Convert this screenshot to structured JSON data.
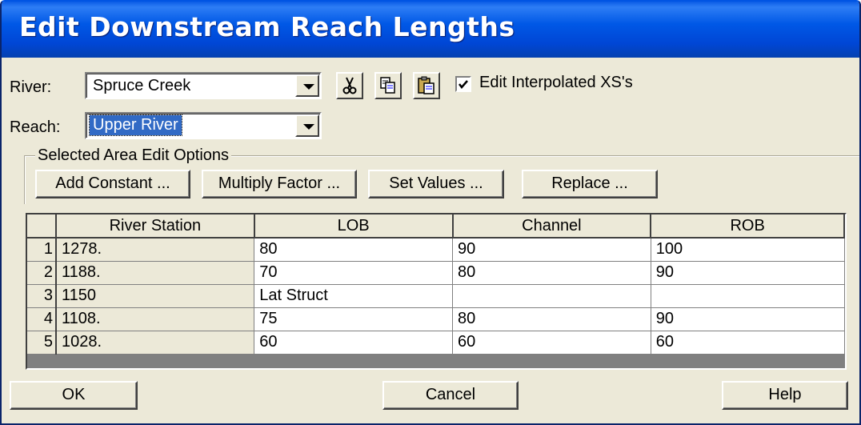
{
  "window": {
    "title": "Edit Downstream Reach Lengths"
  },
  "river": {
    "label": "River:",
    "value": "Spruce Creek"
  },
  "reach": {
    "label": "Reach:",
    "value": "Upper River"
  },
  "toolbar": {
    "cut_icon": "scissors-icon",
    "copy_icon": "copy-icon",
    "paste_icon": "paste-icon"
  },
  "interpolated": {
    "label": "Edit Interpolated XS's",
    "checked": true
  },
  "edit_options": {
    "legend": "Selected Area Edit Options",
    "add_constant": "Add Constant ...",
    "multiply_factor": "Multiply Factor ...",
    "set_values": "Set Values ...",
    "replace": "Replace ..."
  },
  "table": {
    "headers": [
      "River Station",
      "LOB",
      "Channel",
      "ROB"
    ],
    "rows": [
      {
        "num": "1",
        "station": "1278.",
        "lob": "80",
        "channel": "90",
        "rob": "100"
      },
      {
        "num": "2",
        "station": "1188.",
        "lob": "70",
        "channel": "80",
        "rob": "90"
      },
      {
        "num": "3",
        "station": "1150",
        "lob": "Lat Struct",
        "channel": "",
        "rob": ""
      },
      {
        "num": "4",
        "station": "1108.",
        "lob": "75",
        "channel": "80",
        "rob": "90"
      },
      {
        "num": "5",
        "station": "1028.",
        "lob": "60",
        "channel": "60",
        "rob": "60"
      }
    ]
  },
  "footer": {
    "ok": "OK",
    "cancel": "Cancel",
    "help": "Help"
  }
}
